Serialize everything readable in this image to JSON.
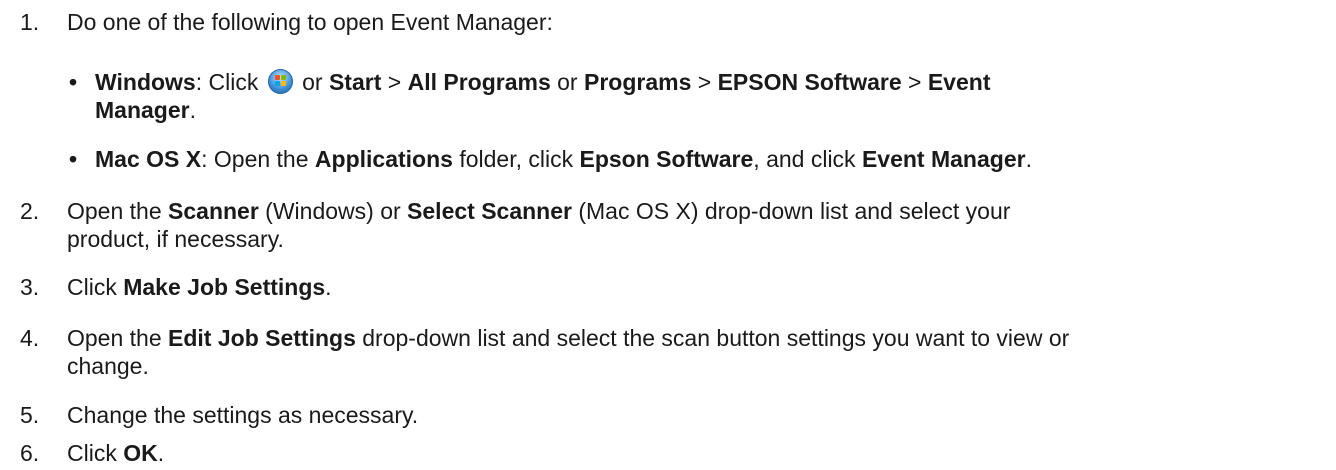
{
  "steps": [
    {
      "num": "1.",
      "text": "Do one of the following to open Event Manager:",
      "bullets": [
        {
          "marker": "•",
          "windows_label": "Windows",
          "t1": ": Click ",
          "icon": "windows-start-orb",
          "t2": " or ",
          "start": "Start",
          "sep1": " > ",
          "all_programs": "All Programs",
          "t3": " or ",
          "programs": "Programs",
          "sep2": " > ",
          "epson_software": "EPSON Software",
          "sep3": " > ",
          "event": "Event",
          "manager": "Manager",
          "end": "."
        },
        {
          "marker": "•",
          "mac_label": "Mac OS X",
          "t1": ": Open the ",
          "applications": "Applications",
          "t2": " folder, click ",
          "epson_software": "Epson Software",
          "t3": ", and click ",
          "event_manager": "Event Manager",
          "end": "."
        }
      ]
    },
    {
      "num": "2.",
      "t1": "Open the ",
      "scanner": "Scanner",
      "t2": " (Windows) or ",
      "select_scanner": "Select Scanner",
      "t3": " (Mac OS X) drop-down list and select your",
      "line2": "product, if necessary."
    },
    {
      "num": "3.",
      "t1": "Click ",
      "make_job_settings": "Make Job Settings",
      "end": "."
    },
    {
      "num": "4.",
      "t1": "Open the ",
      "edit_job_settings": "Edit Job Settings",
      "t2": " drop-down list and select the scan button settings you want to view or",
      "line2": "change."
    },
    {
      "num": "5.",
      "text": "Change the settings as necessary."
    },
    {
      "num": "6.",
      "t1": "Click ",
      "ok": "OK",
      "end": "."
    }
  ]
}
